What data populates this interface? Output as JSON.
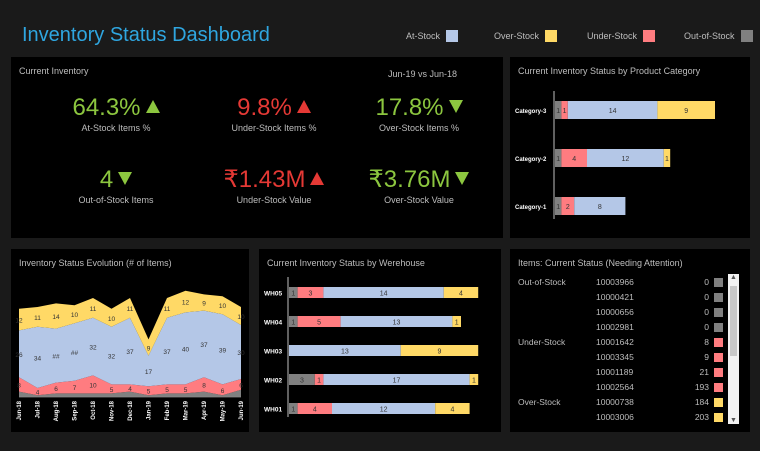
{
  "header": {
    "title": "Inventory Status Dashboard"
  },
  "legend": [
    {
      "label": "At-Stock",
      "color": "#b4c7e7"
    },
    {
      "label": "Over-Stock",
      "color": "#ffd966"
    },
    {
      "label": "Under-Stock",
      "color": "#ff7c80"
    },
    {
      "label": "Out-of-Stock",
      "color": "#808080"
    }
  ],
  "current": {
    "title": "Current Inventory",
    "period": "Jun-19 vs Jun-18",
    "kpis": [
      {
        "value": "64.3%",
        "label": "At-Stock Items %",
        "dir": "up",
        "color": "g"
      },
      {
        "value": "9.8%",
        "label": "Under-Stock Items %",
        "dir": "up",
        "color": "r"
      },
      {
        "value": "17.8%",
        "label": "Over-Stock Items %",
        "dir": "down",
        "color": "g"
      },
      {
        "value": "4",
        "label": "Out-of-Stock Items",
        "dir": "down",
        "color": "g"
      },
      {
        "value": "₹1.43M",
        "label": "Under-Stock Value",
        "dir": "up",
        "color": "r"
      },
      {
        "value": "₹3.76M",
        "label": "Over-Stock Value",
        "dir": "down",
        "color": "g"
      }
    ]
  },
  "panels": {
    "category_title": "Current Inventory Status by Product Category",
    "evolution_title": "Inventory Status Evolution (# of Items)",
    "warehouse_title": "Current Inventory Status by Werehouse",
    "items_title": "Items: Current Status (Needing Attention)"
  },
  "chart_data": [
    {
      "type": "bar",
      "orientation": "horizontal-stacked",
      "title": "Current Inventory Status by Product Category",
      "categories": [
        "Category-3",
        "Category-2",
        "Category-1"
      ],
      "series": [
        {
          "name": "Out-of-Stock",
          "values": [
            1,
            1,
            1
          ]
        },
        {
          "name": "Under-Stock",
          "values": [
            1,
            4,
            2
          ]
        },
        {
          "name": "At-Stock",
          "values": [
            14,
            12,
            8
          ]
        },
        {
          "name": "Over-Stock",
          "values": [
            9,
            1,
            0
          ]
        }
      ]
    },
    {
      "type": "area",
      "title": "Inventory Status Evolution (# of Items)",
      "x": [
        "Jun-18",
        "Jul-18",
        "Aug-18",
        "Sep-18",
        "Oct-18",
        "Nov-18",
        "Dec-18",
        "Jan-19",
        "Feb-19",
        "Mar-19",
        "Apr-19",
        "May-19",
        "Jun-19"
      ],
      "series": [
        {
          "name": "Out-of-Stock",
          "values": [
            3,
            1,
            2,
            2,
            2,
            2,
            3,
            1,
            2,
            2,
            3,
            1,
            4
          ]
        },
        {
          "name": "Under-Stock",
          "values": [
            8,
            4,
            6,
            7,
            10,
            5,
            4,
            5,
            5,
            5,
            8,
            6,
            6
          ]
        },
        {
          "name": "At-Stock",
          "values": [
            26,
            34,
            null,
            null,
            32,
            32,
            37,
            17,
            37,
            40,
            37,
            39,
            30
          ]
        },
        {
          "name": "Over-Stock",
          "values": [
            12,
            11,
            14,
            10,
            11,
            10,
            11,
            9,
            11,
            12,
            9,
            10,
            10
          ]
        }
      ],
      "labels_shown": {
        "At-Stock": [
          "26",
          "34",
          "##",
          "##",
          "32",
          "32",
          "37",
          "17",
          "37",
          "40",
          "37",
          "39",
          "30"
        ]
      }
    },
    {
      "type": "bar",
      "orientation": "horizontal-stacked",
      "title": "Current Inventory Status by Werehouse",
      "categories": [
        "WH05",
        "WH04",
        "WH03",
        "WH02",
        "WH01"
      ],
      "series": [
        {
          "name": "Out-of-Stock",
          "values": [
            1,
            1,
            0,
            3,
            1
          ]
        },
        {
          "name": "Under-Stock",
          "values": [
            3,
            5,
            0,
            1,
            4
          ]
        },
        {
          "name": "At-Stock",
          "values": [
            14,
            13,
            13,
            17,
            12
          ]
        },
        {
          "name": "Over-Stock",
          "values": [
            4,
            1,
            9,
            1,
            4
          ]
        }
      ]
    }
  ],
  "items": [
    {
      "group": "Out-of-Stock",
      "id": "10003966",
      "count": "0",
      "color": "#808080"
    },
    {
      "group": "",
      "id": "10000421",
      "count": "0",
      "color": "#808080"
    },
    {
      "group": "",
      "id": "10000656",
      "count": "0",
      "color": "#808080"
    },
    {
      "group": "",
      "id": "10002981",
      "count": "0",
      "color": "#808080"
    },
    {
      "group": "Under-Stock",
      "id": "10001642",
      "count": "8",
      "color": "#ff7c80"
    },
    {
      "group": "",
      "id": "10003345",
      "count": "9",
      "color": "#ff7c80"
    },
    {
      "group": "",
      "id": "10001189",
      "count": "21",
      "color": "#ff7c80"
    },
    {
      "group": "",
      "id": "10002564",
      "count": "193",
      "color": "#ff7c80"
    },
    {
      "group": "Over-Stock",
      "id": "10000738",
      "count": "184",
      "color": "#ffd966"
    },
    {
      "group": "",
      "id": "10003006",
      "count": "203",
      "color": "#ffd966"
    }
  ]
}
